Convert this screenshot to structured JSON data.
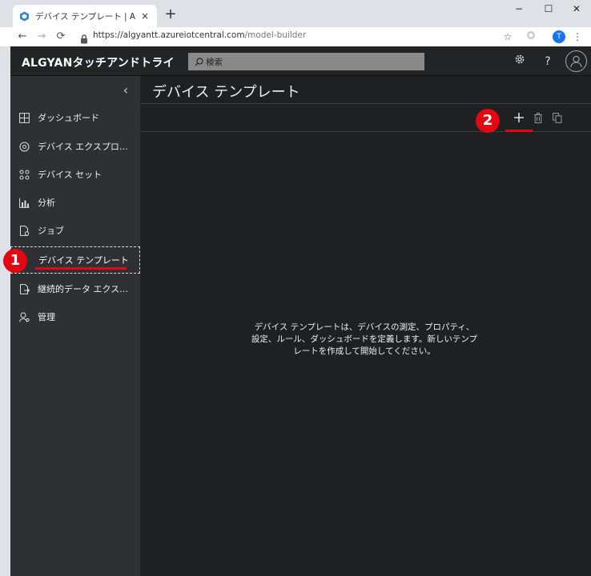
{
  "browser": {
    "tab_title": "デバイス テンプレート | ALGYANタッチ",
    "tab_close": "×",
    "new_tab": "+",
    "window_controls": [
      "−",
      "☐",
      "✕"
    ],
    "nav": {
      "back": "←",
      "forward": "→",
      "reload": "⟳"
    },
    "url_host": "https://algyantt.azureiotcentral.com",
    "url_path": "/model-builder",
    "profile_initial": "T",
    "icons": [
      "star-icon",
      "extension-icon",
      "menu-icon"
    ]
  },
  "app": {
    "brand": "ALGYANタッチアンドトライ",
    "search_placeholder": "検索",
    "top_icons": [
      "gear-icon",
      "help-icon",
      "account-icon"
    ],
    "help_glyph": "?"
  },
  "sidebar": {
    "collapse_glyph": "‹",
    "items": [
      {
        "label": "ダッシュボード",
        "icon": "dashboard-icon"
      },
      {
        "label": "デバイス エクスプロー...",
        "icon": "device-explorer-icon"
      },
      {
        "label": "デバイス セット",
        "icon": "device-sets-icon"
      },
      {
        "label": "分析",
        "icon": "analytics-icon"
      },
      {
        "label": "ジョブ",
        "icon": "jobs-icon"
      },
      {
        "label": "デバイス テンプレート",
        "icon": "device-templates-icon",
        "selected": true
      },
      {
        "label": "継続的データ エクスポ...",
        "icon": "export-icon"
      },
      {
        "label": "管理",
        "icon": "admin-icon"
      }
    ]
  },
  "main": {
    "title": "デバイス テンプレート",
    "empty_line1": "デバイス テンプレートは、デバイスの測定、プロパティ、",
    "empty_line2": "設定、ルール、ダッシュボードを定義します。新しいテンプ",
    "empty_line3": "レートを作成して開始してください。",
    "commands": [
      "add-icon",
      "delete-icon",
      "copy-icon"
    ]
  },
  "annotations": {
    "badge1": "1",
    "badge2": "2",
    "color": "#e30613"
  }
}
